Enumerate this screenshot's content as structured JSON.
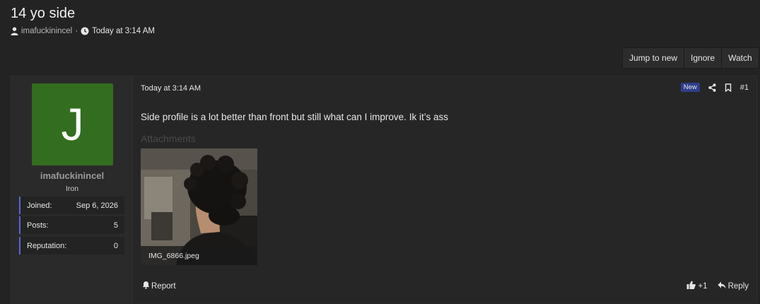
{
  "thread": {
    "title": "14 yo side",
    "author": "imafuckinincel",
    "separator": "·",
    "time": "Today at 3:14 AM"
  },
  "toolbar": {
    "jump_label": "Jump to new",
    "ignore_label": "Ignore",
    "watch_label": "Watch"
  },
  "user": {
    "avatar_letter": "J",
    "avatar_color": "#336d1f",
    "name": "imafuckinincel",
    "title": "Iron",
    "stats": [
      {
        "label": "Joined:",
        "value": "Sep 6, 2026"
      },
      {
        "label": "Posts:",
        "value": "5"
      },
      {
        "label": "Reputation:",
        "value": "0"
      }
    ]
  },
  "post": {
    "date": "Today at 3:14 AM",
    "badge": "New",
    "number": "#1",
    "body": "Side profile is a lot better than front but still what can I improve. Ik it’s ass",
    "attachments_label": "Attachments",
    "attachment_name": "IMG_6866.jpeg",
    "report_label": "Report",
    "like_count": "+1",
    "reply_label": "Reply"
  },
  "colors": {
    "accent": "#5865d8",
    "badge": "#2e3e8a"
  }
}
